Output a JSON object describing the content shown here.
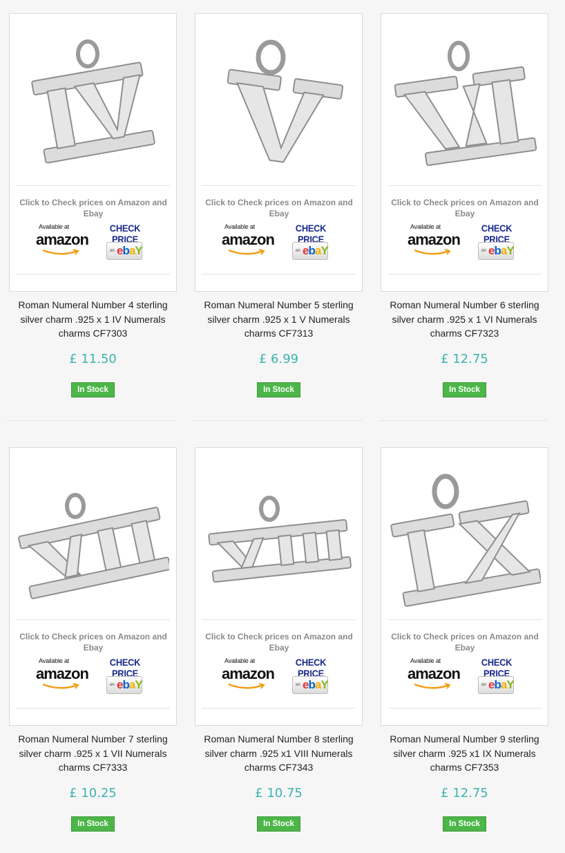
{
  "products": [
    {
      "title": "Roman Numeral Number 4 sterling silver charm .925 x 1 IV Numerals charms CF7303",
      "price": "£ 11.50",
      "stock": "In Stock",
      "numeral": "IV"
    },
    {
      "title": "Roman Numeral Number 5 sterling silver charm .925 x 1 V Numerals charms CF7313",
      "price": "£ 6.99",
      "stock": "In Stock",
      "numeral": "V"
    },
    {
      "title": "Roman Numeral Number 6 sterling silver charm .925 x 1 VI Numerals charms CF7323",
      "price": "£ 12.75",
      "stock": "In Stock",
      "numeral": "VI"
    },
    {
      "title": "Roman Numeral Number 7 sterling silver charm .925 x 1 VII Numerals charms CF7333",
      "price": "£ 10.25",
      "stock": "In Stock",
      "numeral": "VII"
    },
    {
      "title": "Roman Numeral Number 8 sterling silver charm .925 x1 VIII Numerals charms CF7343",
      "price": "£ 10.75",
      "stock": "In Stock",
      "numeral": "VIII"
    },
    {
      "title": "Roman Numeral Number 9 sterling silver charm .925 x1 IX Numerals charms CF7353",
      "price": "£ 12.75",
      "stock": "In Stock",
      "numeral": "IX"
    }
  ],
  "check_prices_text": "Click to Check prices on Amazon and Ebay",
  "amazon": {
    "available_at": "Available at",
    "wordmark": "amazon"
  },
  "ebay": {
    "check_price": "CHECK PRICE",
    "on": "on",
    "wordmark_e": "e",
    "wordmark_b": "b",
    "wordmark_a": "a",
    "wordmark_y": "Y"
  },
  "colors": {
    "price": "#3bb3b0",
    "stock_badge": "#4cb648",
    "page_bg": "#f6f6f6"
  }
}
